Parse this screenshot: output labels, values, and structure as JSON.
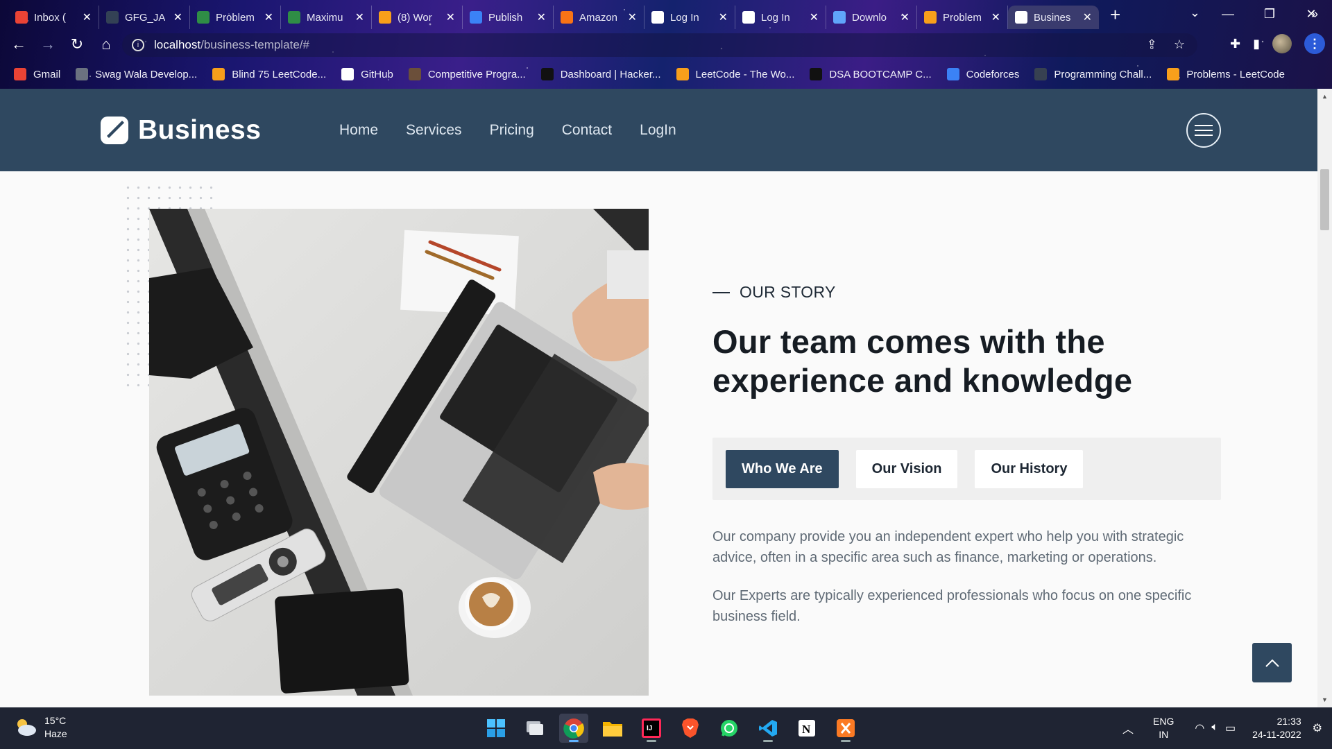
{
  "browser": {
    "tabs": [
      {
        "title": "Inbox (",
        "icon": "gmail-icon",
        "color": "#ea4335"
      },
      {
        "title": "GFG_JA",
        "icon": "github-avatar-icon",
        "color": "#334155"
      },
      {
        "title": "Problem",
        "icon": "gfg-icon",
        "color": "#2f8d46"
      },
      {
        "title": "Maximu",
        "icon": "gfg-icon",
        "color": "#2f8d46"
      },
      {
        "title": "(8) Wor",
        "icon": "leetcode-icon",
        "color": "#f89f1b"
      },
      {
        "title": "Publish",
        "icon": "chart-icon",
        "color": "#3b82f6"
      },
      {
        "title": "Amazon",
        "icon": "aws-icon",
        "color": "#f97316"
      },
      {
        "title": "Log In",
        "icon": "chat-icon",
        "color": "#ffffff"
      },
      {
        "title": "Log In",
        "icon": "chat-icon",
        "color": "#ffffff"
      },
      {
        "title": "Downlo",
        "icon": "download-icon",
        "color": "#60a5fa"
      },
      {
        "title": "Problem",
        "icon": "leetcode-icon",
        "color": "#f89f1b"
      },
      {
        "title": "Busines",
        "icon": "globe-icon",
        "color": "#ffffff",
        "active": true
      }
    ],
    "new_tab": "+",
    "url_host": "localhost",
    "url_path": "/business-template/#",
    "bookmarks": [
      {
        "label": "Gmail",
        "icon": "gmail-icon",
        "color": "#ea4335"
      },
      {
        "label": "Swag Wala Develop...",
        "icon": "globe-icon",
        "color": "#6b7280"
      },
      {
        "label": "Blind 75 LeetCode...",
        "icon": "leetcode-icon",
        "color": "#f89f1b"
      },
      {
        "label": "GitHub",
        "icon": "github-icon",
        "color": "#ffffff"
      },
      {
        "label": "Competitive Progra...",
        "icon": "cc-icon",
        "color": "#6b4f3a"
      },
      {
        "label": "Dashboard | Hacker...",
        "icon": "hackerrank-icon",
        "color": "#111111"
      },
      {
        "label": "LeetCode - The Wo...",
        "icon": "leetcode-icon",
        "color": "#f89f1b"
      },
      {
        "label": "DSA BOOTCAMP C...",
        "icon": "notion-icon",
        "color": "#111111"
      },
      {
        "label": "Codeforces",
        "icon": "codeforces-icon",
        "color": "#3b82f6"
      },
      {
        "label": "Programming Chall...",
        "icon": "globe-icon",
        "color": "#374151"
      },
      {
        "label": "Problems - LeetCode",
        "icon": "leetcode-icon",
        "color": "#f89f1b"
      }
    ],
    "bookmarks_more": "»"
  },
  "site": {
    "brand": "Business",
    "nav": [
      "Home",
      "Services",
      "Pricing",
      "Contact",
      "LogIn"
    ]
  },
  "story": {
    "eyebrow": "OUR STORY",
    "heading_line1": "Our team comes with the",
    "heading_line2": "experience and knowledge",
    "tabs": [
      "Who We Are",
      "Our Vision",
      "Our History"
    ],
    "active_tab": 0,
    "paragraph1": "Our company provide you an independent expert who help you with strategic advice, often in a specific area such as finance, marketing or operations.",
    "paragraph2": "Our Experts are typically experienced professionals who focus on one specific business field."
  },
  "taskbar": {
    "temperature": "15°C",
    "condition": "Haze",
    "lang_line1": "ENG",
    "lang_line2": "IN",
    "time": "21:33",
    "date": "24-11-2022"
  },
  "colors": {
    "header_bg": "#2f4860",
    "accent": "#2f4860",
    "text_dark": "#161c23",
    "text_muted": "#5f6a75"
  }
}
